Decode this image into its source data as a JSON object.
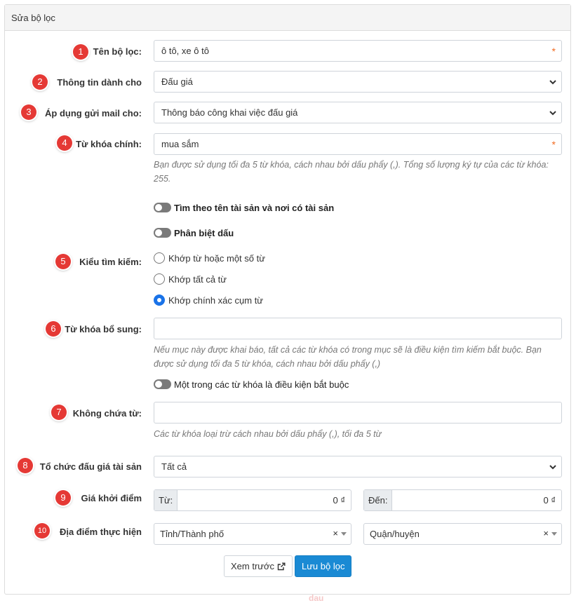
{
  "panel": {
    "title": "Sửa bộ lọc"
  },
  "fields": {
    "ten_bo_loc": {
      "badge": "1",
      "label": "Tên bộ lọc:",
      "value": "ô tô, xe ô tô",
      "required": "*"
    },
    "thong_tin": {
      "badge": "2",
      "label": "Thông tin dành cho",
      "value": "Đấu giá"
    },
    "gui_mail": {
      "badge": "3",
      "label": "Áp dụng gửi mail cho:",
      "value": "Thông báo công khai việc đấu giá"
    },
    "tu_khoa_chinh": {
      "badge": "4",
      "label": "Từ khóa chính:",
      "value": "mua sắm",
      "required": "*",
      "help": "Bạn được sử dụng tối đa 5 từ khóa, cách nhau bởi dấu phẩy (,). Tổng số lượng ký tự của các từ khóa: 255."
    },
    "toggles": [
      {
        "label": "Tìm theo tên tài sản và nơi có tài sản",
        "on": false
      },
      {
        "label": "Phân biệt dấu",
        "on": false
      }
    ],
    "kieu_tim_kiem": {
      "badge": "5",
      "label": "Kiểu tìm kiếm:",
      "options": [
        {
          "label": "Khớp từ hoặc một số từ",
          "checked": false
        },
        {
          "label": "Khớp tất cả từ",
          "checked": false
        },
        {
          "label": "Khớp chính xác cụm từ",
          "checked": true
        }
      ]
    },
    "tu_khoa_bo_sung": {
      "badge": "6",
      "label": "Từ khóa bổ sung:",
      "value": "",
      "help": "Nếu mục này được khai báo, tất cả các từ khóa có trong mục sẽ là điều kiện tìm kiếm bắt buộc. Bạn được sử dụng tối đa 5 từ khóa, cách nhau bởi dấu phẩy (,)",
      "toggle_label": "Một trong các từ khóa là điều kiện bắt buộc"
    },
    "khong_chua_tu": {
      "badge": "7",
      "label": "Không chứa từ:",
      "value": "",
      "help": "Các từ khóa loại trừ cách nhau bởi dấu phẩy (,), tối đa 5 từ"
    },
    "to_chuc": {
      "badge": "8",
      "label": "Tổ chức đấu giá tài sản",
      "value": "Tất cả"
    },
    "gia_khoi_diem": {
      "badge": "9",
      "label": "Giá khởi điểm",
      "from_label": "Từ:",
      "from_value": "0 ₫",
      "to_label": "Đến:",
      "to_value": "0 ₫"
    },
    "dia_diem": {
      "badge": "10",
      "label": "Địa điểm thực hiện",
      "province": "Tỉnh/Thành phố",
      "district": "Quận/huyện",
      "clear": "×"
    }
  },
  "buttons": {
    "preview": "Xem trước",
    "save": "Lưu bộ lọc"
  },
  "watermark": "dau"
}
